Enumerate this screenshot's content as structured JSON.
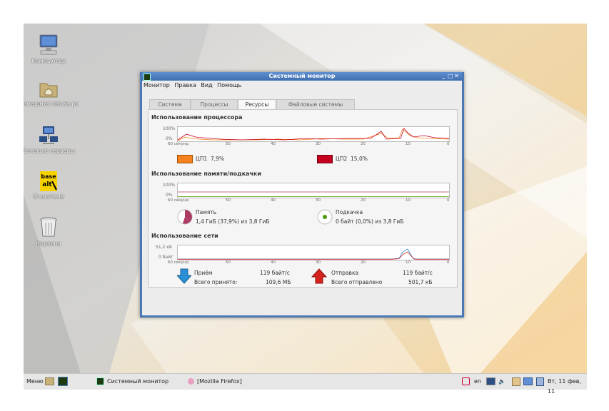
{
  "desktop": {
    "icons": [
      {
        "label": "Компьютер",
        "icon": "computer-icon"
      },
      {
        "label": "Домашняя папка pc",
        "icon": "home-folder-icon"
      },
      {
        "label": "Сетевые серверы",
        "icon": "network-servers-icon"
      },
      {
        "label": "О системе",
        "icon": "base-alt-logo-icon",
        "logo_text": "base alt"
      },
      {
        "label": "Корзина",
        "icon": "trash-icon"
      }
    ]
  },
  "window": {
    "title": "Системный монитор",
    "menu": [
      "Монитор",
      "Правка",
      "Вид",
      "Помощь"
    ],
    "tabs": [
      "Система",
      "Процессы",
      "Ресурсы",
      "Файловые системы"
    ],
    "active_tab": "Ресурсы",
    "x_ticks": [
      "60 секунд",
      "50",
      "40",
      "30",
      "20",
      "10",
      "0"
    ],
    "cpu": {
      "title": "Использование процессора",
      "y_top": "100%",
      "y_bottom": "0%",
      "cpu1": {
        "label": "ЦП1",
        "value": "7,9%",
        "color": "#f5821f"
      },
      "cpu2": {
        "label": "ЦП2",
        "value": "15,0%",
        "color": "#c4001e"
      }
    },
    "memory": {
      "title": "Использование памяти/подкачки",
      "y_top": "100%",
      "y_bottom": "0%",
      "mem_label": "Память",
      "mem_value": "1,4 ГиБ (37,9%) из 3,8 ГиБ",
      "mem_color": "#ad3c64",
      "swap_label": "Подкачка",
      "swap_value": "0 байт (0,0%) из 3,8 ГиБ",
      "swap_color": "#4e9a06"
    },
    "network": {
      "title": "Использование сети",
      "y_top": "51,2 кБ",
      "y_bottom": "0 байт",
      "rx_label": "Приём",
      "rx_rate": "119 байт/с",
      "rx_total_label": "Всего принято:",
      "rx_total": "109,6 МБ",
      "tx_label": "Отправка",
      "tx_rate": "119 байт/с",
      "tx_total_label": "Всего отправлено",
      "tx_total": "501,7 кБ",
      "rx_color": "#2a8fd6",
      "tx_color": "#d4231f"
    }
  },
  "taskbar": {
    "menu_label": "Меню",
    "tasks": [
      "Системный монитор",
      "[Mozilla Firefox]"
    ],
    "lang": "en",
    "clock": "Вт, 11 фев, 11"
  }
}
